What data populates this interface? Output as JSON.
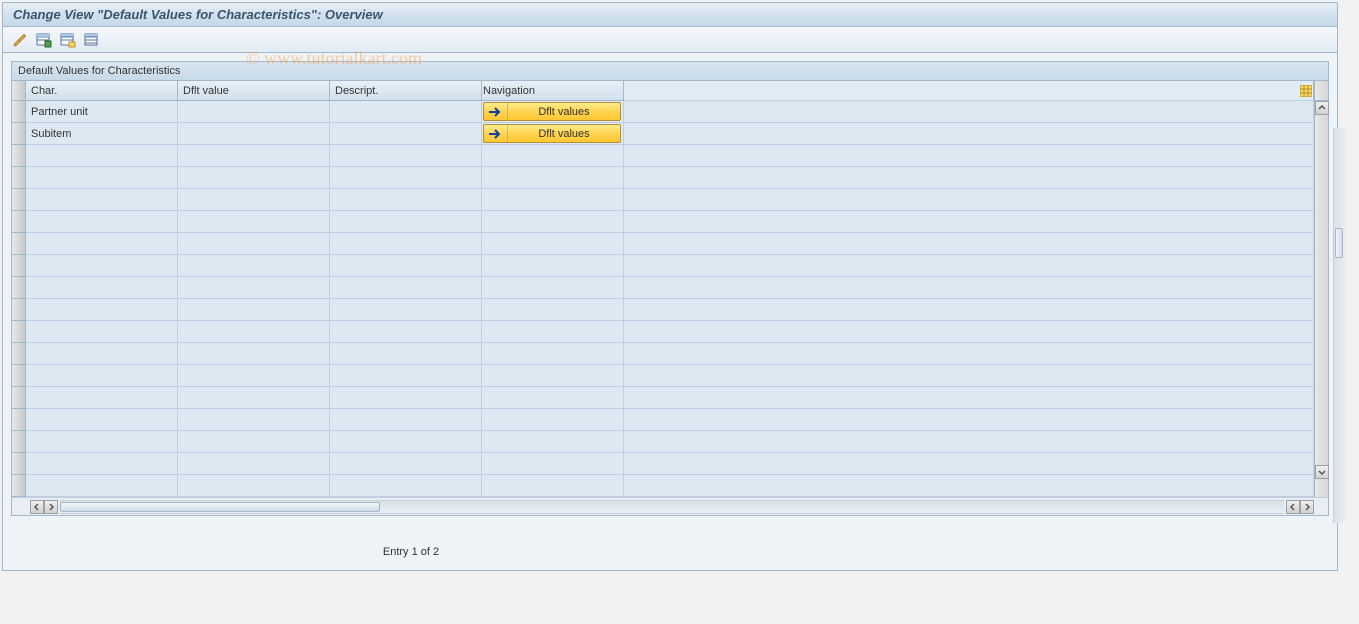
{
  "window": {
    "title": "Change View \"Default Values for Characteristics\": Overview"
  },
  "toolbar": {
    "icons": [
      "edit-pencils",
      "table-new",
      "table-select",
      "table-deselect"
    ]
  },
  "panel": {
    "title": "Default Values for Characteristics"
  },
  "table": {
    "headers": {
      "char": "Char.",
      "dflt_value": "Dflt value",
      "descript": "Descript.",
      "navigation": "Navigation"
    },
    "rows": [
      {
        "char": "Partner unit",
        "dflt_value": "",
        "descript": "",
        "nav_label": "Dflt values"
      },
      {
        "char": "Subitem",
        "dflt_value": "",
        "descript": "",
        "nav_label": "Dflt values"
      }
    ],
    "empty_row_count": 16
  },
  "status": {
    "entry_text": "Entry 1 of 2"
  },
  "watermark": "© www.tutorialkart.com"
}
